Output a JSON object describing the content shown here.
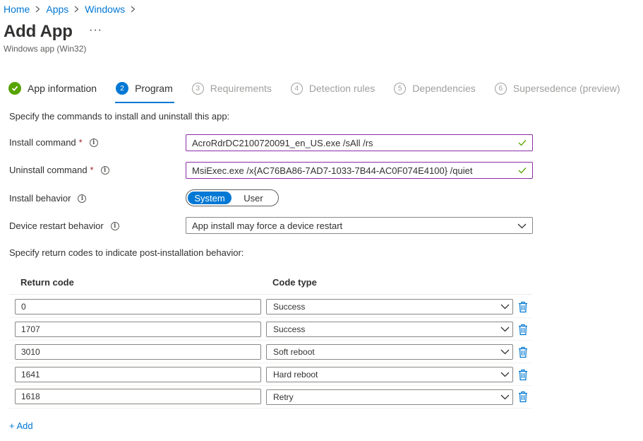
{
  "breadcrumb": {
    "items": [
      "Home",
      "Apps",
      "Windows"
    ]
  },
  "page": {
    "title": "Add App",
    "more": "···",
    "subtitle": "Windows app (Win32)"
  },
  "steps": [
    {
      "num": "",
      "label": "App information",
      "state": "done"
    },
    {
      "num": "2",
      "label": "Program",
      "state": "active"
    },
    {
      "num": "3",
      "label": "Requirements",
      "state": "pending"
    },
    {
      "num": "4",
      "label": "Detection rules",
      "state": "pending"
    },
    {
      "num": "5",
      "label": "Dependencies",
      "state": "pending"
    },
    {
      "num": "6",
      "label": "Supersedence (preview)",
      "state": "pending"
    }
  ],
  "form": {
    "intro": "Specify the commands to install and uninstall this app:",
    "install_label": "Install command",
    "install_value": "AcroRdrDC2100720091_en_US.exe /sAll /rs",
    "uninstall_label": "Uninstall command",
    "uninstall_value": "MsiExec.exe /x{AC76BA86-7AD7-1033-7B44-AC0F074E4100} /quiet",
    "required_mark": "*",
    "behavior_label": "Install behavior",
    "behavior_options": [
      "System",
      "User"
    ],
    "behavior_selected": "System",
    "restart_label": "Device restart behavior",
    "restart_value": "App install may force a device restart",
    "return_intro": "Specify return codes to indicate post-installation behavior:"
  },
  "table": {
    "col_code": "Return code",
    "col_type": "Code type",
    "rows": [
      {
        "code": "0",
        "type": "Success"
      },
      {
        "code": "1707",
        "type": "Success"
      },
      {
        "code": "3010",
        "type": "Soft reboot"
      },
      {
        "code": "1641",
        "type": "Hard reboot"
      },
      {
        "code": "1618",
        "type": "Retry"
      }
    ]
  },
  "add_label": "+ Add",
  "colors": {
    "accent": "#0078d4",
    "success": "#57a300",
    "required": "#a4262c",
    "focus_border": "#8a2da5"
  },
  "icons": {
    "step_done": "check-circle-icon",
    "info": "info-icon",
    "valid": "checkmark-icon",
    "dropdown": "chevron-down-icon",
    "delete": "trash-icon",
    "breadcrumb_sep": "chevron-right-icon"
  }
}
